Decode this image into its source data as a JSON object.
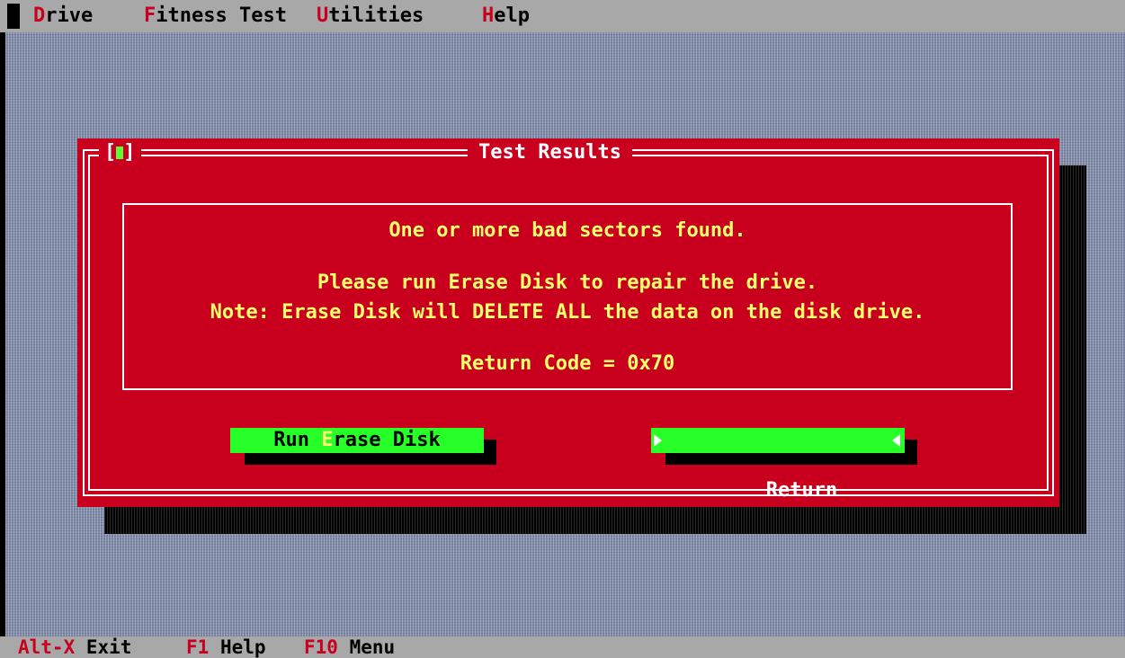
{
  "menubar": {
    "items": [
      {
        "hotkey": "D",
        "rest": "rive"
      },
      {
        "hotkey": "F",
        "rest": "itness Test"
      },
      {
        "hotkey": "U",
        "rest": "tilities"
      },
      {
        "hotkey": "H",
        "rest": "elp"
      }
    ]
  },
  "dialog": {
    "title": "Test Results",
    "close_box": {
      "left": "[",
      "right": "]"
    },
    "messages": {
      "line1": "One or more bad sectors found.",
      "line2": "Please run Erase Disk to repair the drive.",
      "line3": "Note: Erase Disk will DELETE ALL the data on the disk drive.",
      "line4": "Return Code = 0x70"
    },
    "buttons": {
      "run_erase": {
        "prefix": "Run ",
        "hotkey": "E",
        "rest": "rase Disk"
      },
      "return": {
        "label": "Return"
      }
    }
  },
  "statusbar": {
    "items": [
      {
        "key": "Alt-X",
        "label": " Exit"
      },
      {
        "key": "F1",
        "label": " Help"
      },
      {
        "key": "F10",
        "label": " Menu"
      }
    ]
  },
  "colors": {
    "dialog_bg": "#c8001e",
    "desktop_bg": "#7e8aa8",
    "bar_bg": "#a8a8a8",
    "button_bg": "#28ff28",
    "message_text": "#ffff6e",
    "hotkey": "#c8001e"
  }
}
